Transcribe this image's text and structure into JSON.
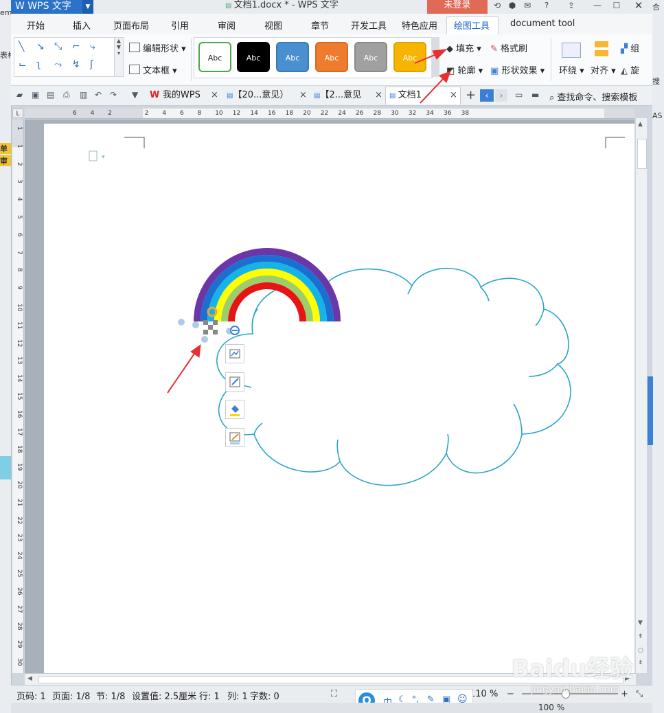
{
  "app": {
    "name": "WPS 文字",
    "doc_title": "文档1.docx * - WPS 文字",
    "login": "未登录"
  },
  "menu": {
    "tabs": [
      "开始",
      "插入",
      "页面布局",
      "引用",
      "审阅",
      "视图",
      "章节",
      "开发工具",
      "特色应用",
      "绘图工具",
      "document tool"
    ],
    "active": "绘图工具"
  },
  "ribbon": {
    "edit_shape": "编辑形状",
    "text_box": "文本框",
    "style_label": "Abc",
    "styles": [
      {
        "bg": "#ffffff",
        "border": "#4ca64c",
        "fg": "#222222"
      },
      {
        "bg": "#000000",
        "border": "#000000",
        "fg": "#ffffff"
      },
      {
        "bg": "#4a8fd0",
        "border": "#3d7ab5",
        "fg": "#ffffff"
      },
      {
        "bg": "#ef7b2e",
        "border": "#d86a20",
        "fg": "#ffffff"
      },
      {
        "bg": "#a0a0a0",
        "border": "#8a8a8a",
        "fg": "#ffffff"
      },
      {
        "bg": "#f7b400",
        "border": "#e0a200",
        "fg": "#ffffff"
      }
    ],
    "fill": "填充",
    "format_painter": "格式刷",
    "outline": "轮廓",
    "shape_effect": "形状效果",
    "wrap": "环绕",
    "align": "对齐",
    "rotate": "旋",
    "group": "组"
  },
  "doc_tabs": {
    "my_wps": "我的WPS",
    "tab2": "【20...意见）",
    "tab3": "【2...意见",
    "tab4": "文档1",
    "search": "查找命令、搜索模板"
  },
  "ruler": {
    "h_labels": [
      "6",
      "4",
      "2",
      "2",
      "4",
      "6",
      "8",
      "10",
      "12",
      "14",
      "16",
      "18",
      "20",
      "22",
      "24",
      "26",
      "28",
      "30",
      "32",
      "34",
      "36",
      "38"
    ],
    "v_labels": [
      "1",
      "1",
      "2",
      "3",
      "4",
      "5",
      "6",
      "7",
      "8",
      "9",
      "10",
      "11",
      "12",
      "13",
      "14",
      "15",
      "16",
      "17",
      "18",
      "19",
      "20",
      "21",
      "22",
      "23",
      "24",
      "25",
      "26",
      "27",
      "28",
      "29",
      "30"
    ],
    "corner": "L"
  },
  "status": {
    "page_code": "页码: 1",
    "page": "页面: 1/8",
    "section": "节: 1/8",
    "setting": "设置值: 2.5厘米",
    "row": "行: 1",
    "col": "列: 1",
    "words": "字数: 0",
    "zoom": "110 %",
    "zoom2": "100 %"
  },
  "ime": {
    "lang": "中"
  },
  "bg_left": [
    "em",
    "表格",
    "单",
    "审"
  ],
  "bg_right": [
    "合",
    "搜",
    "AS"
  ],
  "watermark": {
    "line1": "Baidu经验",
    "line2": "jingyan.baidu.com"
  },
  "colors": {
    "rainbow": [
      "#6a36a8",
      "#1a6fd0",
      "#15b3e8",
      "#ffff00",
      "#9ccf6a",
      "#e81414"
    ],
    "cloud_stroke": "#2aa5c8",
    "arrow": "#e83030",
    "accent": "#3b7fd6"
  }
}
